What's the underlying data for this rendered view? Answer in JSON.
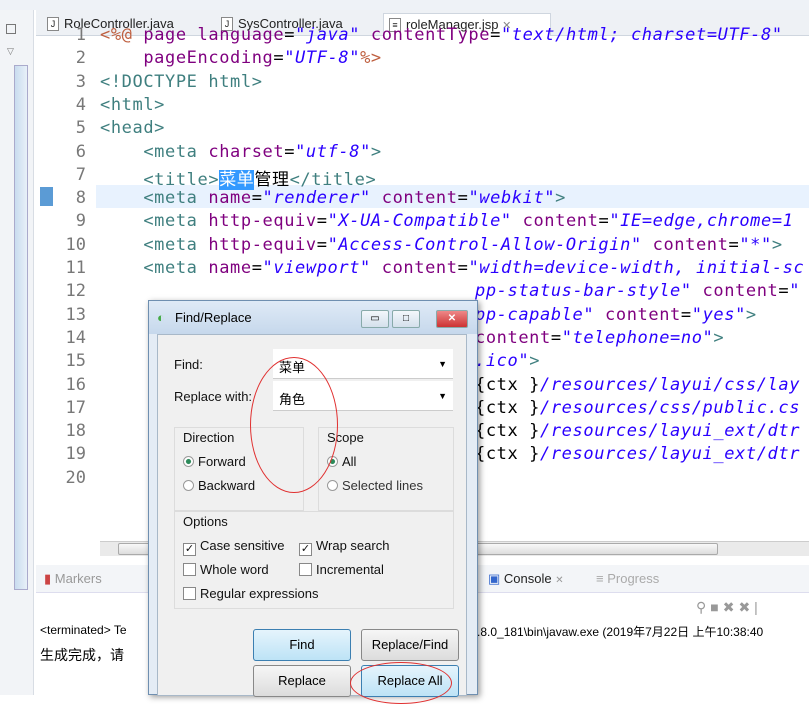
{
  "tabs": [
    {
      "label": "RoleController.java",
      "icon": "java-file-icon"
    },
    {
      "label": "SysController.java",
      "icon": "java-file-icon"
    },
    {
      "label": "roleManager.jsp",
      "icon": "jsp-file-icon",
      "active": true
    }
  ],
  "editor": {
    "lines": [
      {
        "n": "1",
        "html": "<span class='j'>&lt;%@</span> <span class='a'>page language</span><span class='k'>=</span><span class='v'>\"java\"</span> <span class='a'>contentType</span><span class='k'>=</span><span class='v'>\"text/html; charset=UTF-8\"</span>"
      },
      {
        "n": "2",
        "html": "    <span class='a'>pageEncoding</span><span class='k'>=</span><span class='v'>\"UTF-8\"</span><span class='j'>%&gt;</span>"
      },
      {
        "n": "3",
        "html": "&lt;!DOCTYPE <span class='t'>html</span>&gt;"
      },
      {
        "n": "4",
        "html": "&lt;html&gt;"
      },
      {
        "n": "5",
        "html": "&lt;head&gt;"
      },
      {
        "n": "6",
        "html": "    &lt;meta <span class='a'>charset</span><span class='k'>=</span><span class='v'>\"utf-8\"</span>&gt;"
      },
      {
        "n": "7",
        "html": "    &lt;title&gt;<span class='sel'>菜单</span><span class='k'>管理</span>&lt;/title&gt;"
      },
      {
        "n": "8",
        "html": "    &lt;meta <span class='a'>name</span><span class='k'>=</span><span class='v'>\"renderer\"</span> <span class='a'>content</span><span class='k'>=</span><span class='v'>\"webkit\"</span>&gt;"
      },
      {
        "n": "9",
        "html": "    &lt;meta <span class='a'>http-equiv</span><span class='k'>=</span><span class='v'>\"X-UA-Compatible\"</span> <span class='a'>content</span><span class='k'>=</span><span class='v'>\"IE=edge,chrome=1</span>"
      },
      {
        "n": "10",
        "html": "    &lt;meta <span class='a'>http-equiv</span><span class='k'>=</span><span class='v'>\"Access-Control-Allow-Origin\"</span> <span class='a'>content</span><span class='k'>=</span><span class='v'>\"*\"</span>&gt;"
      },
      {
        "n": "11",
        "html": "    &lt;meta <span class='a'>name</span><span class='k'>=</span><span class='v'>\"viewport\"</span> <span class='a'>content</span><span class='k'>=</span><span class='v'>\"width=device-width, initial-sc</span>"
      },
      {
        "n": "12",
        "html": "<span class='v'>pp-status-bar-style\"</span> <span class='a'>content</span><span class='k'>=</span><span class='v'>\"</span>",
        "clip": true
      },
      {
        "n": "13",
        "html": "<span class='v'>pp-capable\"</span> <span class='a'>content</span><span class='k'>=</span><span class='v'>\"yes\"</span>&gt;",
        "clip": true
      },
      {
        "n": "14",
        "html": "<span class='a'>content</span><span class='k'>=</span><span class='v'>\"telephone=no\"</span>&gt;",
        "clip": true
      },
      {
        "n": "15",
        "html": "<span class='v'>.ico\"</span>&gt;",
        "clip": true
      },
      {
        "n": "16",
        "html": "<span class='k'>{ctx }</span><span class='v'>/resources/layui/css/lay</span>",
        "clip": true
      },
      {
        "n": "17",
        "html": "<span class='k'>{ctx }</span><span class='v'>/resources/css/public.cs</span>",
        "clip": true
      },
      {
        "n": "18",
        "html": "<span class='k'>{ctx }</span><span class='v'>/resources/layui_ext/dtr</span>",
        "clip": true
      },
      {
        "n": "19",
        "html": "<span class='k'>{ctx }</span><span class='v'>/resources/layui_ext/dtr</span>",
        "clip": true
      },
      {
        "n": "20",
        "html": ""
      }
    ]
  },
  "console": {
    "tabs": [
      "Markers",
      "Console",
      "Progress"
    ],
    "terminated": "<terminated> Te",
    "path": ".8.0_181\\bin\\javaw.exe (2019年7月22日 上午10:38:40",
    "output": "生成完成，请"
  },
  "dialog": {
    "title": "Find/Replace",
    "find_label": "Find:",
    "find_value": "菜单",
    "replace_label": "Replace with:",
    "replace_value": "角色",
    "direction_label": "Direction",
    "forward": "Forward",
    "backward": "Backward",
    "scope_label": "Scope",
    "all": "All",
    "selected_lines": "Selected lines",
    "options_label": "Options",
    "case_sensitive": "Case sensitive",
    "wrap_search": "Wrap search",
    "whole_word": "Whole word",
    "incremental": "Incremental",
    "regex": "Regular expressions",
    "btn_find": "Find",
    "btn_replace_find": "Replace/Find",
    "btn_replace": "Replace",
    "btn_replace_all": "Replace All",
    "state": {
      "direction": "Forward",
      "scope": "All",
      "case_sensitive": true,
      "wrap_search": true,
      "whole_word": false,
      "incremental": false,
      "regex": false
    }
  },
  "colors": {
    "annotation": "#e03030",
    "selection": "#3399ff"
  }
}
